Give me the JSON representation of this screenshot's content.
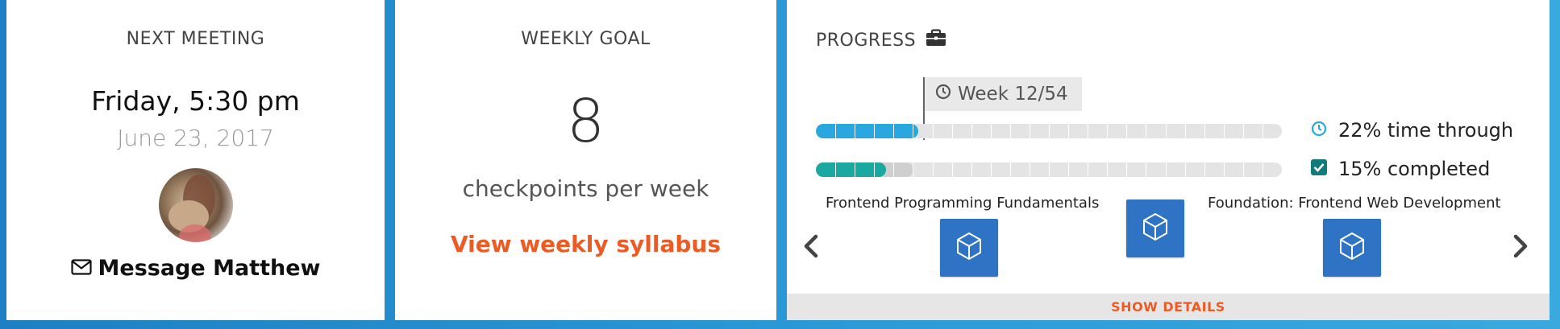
{
  "meeting": {
    "title": "NEXT MEETING",
    "day_time": "Friday, 5:30 pm",
    "date": "June 23, 2017",
    "message_label": "Message Matthew"
  },
  "goal": {
    "title": "WEEKLY GOAL",
    "number": "8",
    "unit": "checkpoints per week",
    "link_label": "View weekly syllabus"
  },
  "progress": {
    "title": "PROGRESS",
    "week_label": "Week 12/54",
    "time_through_label": "22% time through",
    "completed_label": "15% completed",
    "time_fraction": 0.22,
    "completed_fraction": 0.15,
    "pending_fraction": 0.21,
    "courses": [
      {
        "label": "Frontend Programming Fundamentals"
      },
      {
        "label": ""
      },
      {
        "label": "Foundation: Frontend Web Development"
      }
    ],
    "show_details_label": "SHOW DETAILS"
  },
  "colors": {
    "accent_orange": "#ee5a24",
    "time_bar": "#29a8e0",
    "completed_bar": "#1aa8a0",
    "course_box": "#2f73c5",
    "frame_blue": "#2a98d6"
  },
  "icons": {
    "message": "envelope-icon",
    "progress": "briefcase-icon",
    "week": "clock-icon",
    "time_through": "clock-icon",
    "completed": "checkbox-checked-icon",
    "course": "cube-icon",
    "prev": "chevron-left-icon",
    "next": "chevron-right-icon"
  }
}
